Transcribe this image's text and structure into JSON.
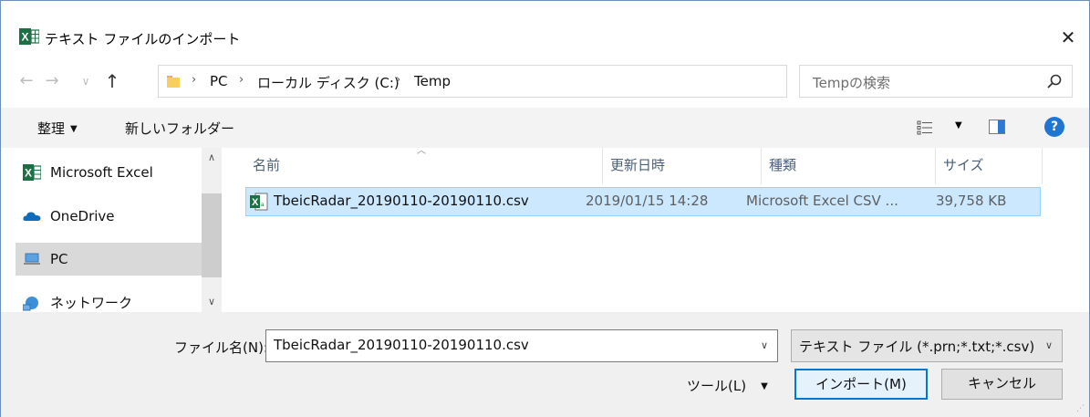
{
  "window": {
    "title": "テキスト ファイルのインポート"
  },
  "address": {
    "crumbs": [
      "PC",
      "ローカル ディスク (C:)",
      "Temp"
    ],
    "search_placeholder": "Tempの検索"
  },
  "toolbar": {
    "organize": "整理",
    "new_folder": "新しいフォルダー"
  },
  "navpane": {
    "items": [
      {
        "label": "Microsoft Excel",
        "icon": "excel-icon"
      },
      {
        "label": "OneDrive",
        "icon": "cloud-icon"
      },
      {
        "label": "PC",
        "icon": "computer-icon",
        "selected": true
      },
      {
        "label": "ネットワーク",
        "icon": "network-icon"
      }
    ]
  },
  "filelist": {
    "columns": [
      "名前",
      "更新日時",
      "種類",
      "サイズ"
    ],
    "rows": [
      {
        "name": "TbeicRadar_20190110-20190110.csv",
        "modified": "2019/01/15 14:28",
        "type": "Microsoft Excel CSV ...",
        "size": "39,758 KB",
        "selected": true
      }
    ]
  },
  "bottom": {
    "filename_label": "ファイル名(N):",
    "filename_value": "TbeicRadar_20190110-20190110.csv",
    "filter_value": "テキスト ファイル (*.prn;*.txt;*.csv)",
    "tools_label": "ツール(L)",
    "import_label": "インポート(M)",
    "cancel_label": "キャンセル"
  },
  "colors": {
    "accent": "#0078d7",
    "selection": "#cce8ff",
    "excel_green": "#1d7044"
  }
}
